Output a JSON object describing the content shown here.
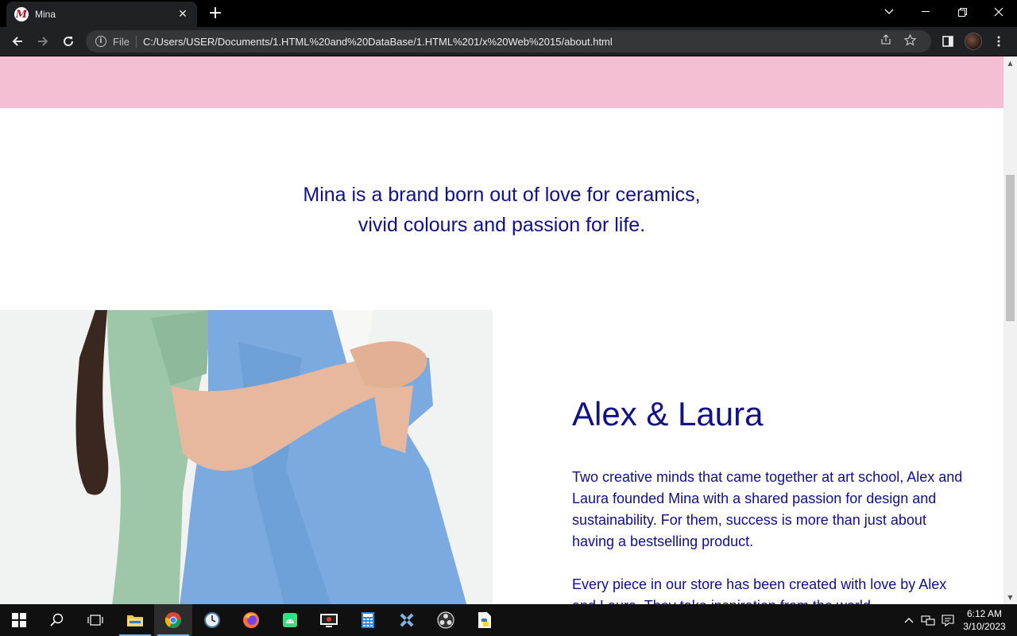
{
  "browser": {
    "tab": {
      "title": "Mina",
      "favicon": "M"
    },
    "address": {
      "scheme_label": "File",
      "url": "C:/Users/USER/Documents/1.HTML%20and%20DataBase/1.HTML%201/x%20Web%2015/about.html"
    }
  },
  "page": {
    "mission_line1": "Mina is a brand born out of love for ceramics,",
    "mission_line2": "vivid colours and passion for life.",
    "about_title": "Alex & Laura",
    "about_p1": "Two creative minds that came together at art school, Alex and Laura founded Mina with a shared passion for design and sustainability. For them, success is more than just about having a bestselling product.",
    "about_p2": "Every piece in our store has been created with love by Alex and Laura. They take inspiration from the world"
  },
  "taskbar": {
    "time": "6:12 AM",
    "date": "3/10/2023"
  },
  "colors": {
    "brand_navy": "#10108a",
    "banner_pink": "#f5bfd3"
  }
}
